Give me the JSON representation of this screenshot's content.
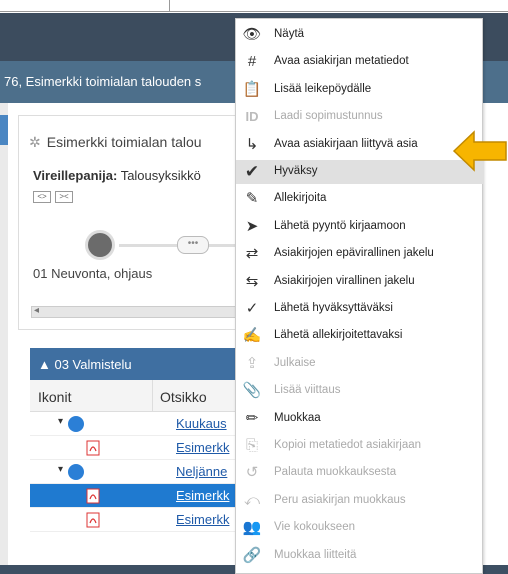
{
  "title_text": "76, Esimerkki toimialan talouden s",
  "panel": {
    "title": "Esimerkki toimialan talou",
    "vireillepanija_label": "Vireillepanija:",
    "vireillepanija_value": "Talousyksikkö",
    "step_label": "01 Neuvonta, ohjaus",
    "step_dots": "•••"
  },
  "section": {
    "title": "03 Valmistelu"
  },
  "table": {
    "headers": [
      "Ikonit",
      "Otsikko"
    ],
    "rows": [
      {
        "type": "folder",
        "title": "Kuukaus",
        "selected": false
      },
      {
        "type": "pdf",
        "title": "Esimerkk",
        "selected": false
      },
      {
        "type": "folder",
        "title": "Neljänne",
        "selected": false
      },
      {
        "type": "pdf",
        "title": "Esimerkk",
        "selected": true
      },
      {
        "type": "pdf",
        "title": "Esimerkk",
        "selected": false
      }
    ]
  },
  "context_menu": {
    "items": [
      {
        "icon": "eye-icon",
        "glyph": "👁",
        "label": "Näytä",
        "enabled": true
      },
      {
        "icon": "hash-icon",
        "glyph": "#",
        "label": "Avaa asiakirjan metatiedot",
        "enabled": true
      },
      {
        "icon": "clipboard-icon",
        "glyph": "📋",
        "label": "Lisää leikepöydälle",
        "enabled": true
      },
      {
        "icon": "id-icon",
        "glyph": "ID",
        "label": "Laadi sopimustunnus",
        "enabled": false
      },
      {
        "icon": "folder-link-icon",
        "glyph": "↳",
        "label": "Avaa asiakirjaan liittyvä asia",
        "enabled": true
      },
      {
        "icon": "checkmark-icon",
        "glyph": "✔",
        "label": "Hyväksy",
        "enabled": true,
        "highlighted": true
      },
      {
        "icon": "sign-icon",
        "glyph": "✎",
        "label": "Allekirjoita",
        "enabled": true
      },
      {
        "icon": "send-registry-icon",
        "glyph": "➤",
        "label": "Lähetä pyyntö kirjaamoon",
        "enabled": true
      },
      {
        "icon": "unofficial-distribution-icon",
        "glyph": "⇄",
        "label": "Asiakirjojen epävirallinen jakelu",
        "enabled": true
      },
      {
        "icon": "official-distribution-icon",
        "glyph": "⇆",
        "label": "Asiakirjojen virallinen jakelu",
        "enabled": true
      },
      {
        "icon": "send-approver-icon",
        "glyph": "✓",
        "label": "Lähetä hyväksyttäväksi",
        "enabled": true
      },
      {
        "icon": "send-signer-icon",
        "glyph": "✍",
        "label": "Lähetä allekirjoitettavaksi",
        "enabled": true
      },
      {
        "icon": "publish-icon",
        "glyph": "⇪",
        "label": "Julkaise",
        "enabled": false
      },
      {
        "icon": "paperclip-icon",
        "glyph": "📎",
        "label": "Lisää viittaus",
        "enabled": false
      },
      {
        "icon": "edit-icon",
        "glyph": "✏",
        "label": "Muokkaa",
        "enabled": true
      },
      {
        "icon": "copy-metadata-icon",
        "glyph": "⎘",
        "label": "Kopioi metatiedot asiakirjaan",
        "enabled": false
      },
      {
        "icon": "restore-icon",
        "glyph": "↺",
        "label": "Palauta muokkauksesta",
        "enabled": false
      },
      {
        "icon": "cancel-edit-icon",
        "glyph": "⤺",
        "label": "Peru asiakirjan muokkaus",
        "enabled": false
      },
      {
        "icon": "meeting-icon",
        "glyph": "👥",
        "label": "Vie kokoukseen",
        "enabled": false
      },
      {
        "icon": "edit-attachments-icon",
        "glyph": "🔗",
        "label": "Muokkaa liitteitä",
        "enabled": false
      }
    ]
  },
  "colors": {
    "header": "#3c4c5e",
    "titlebar": "#4d6f8b",
    "section": "#3f6fa1",
    "selected_row": "#1f7ad0",
    "arrow": "#f7b500"
  }
}
